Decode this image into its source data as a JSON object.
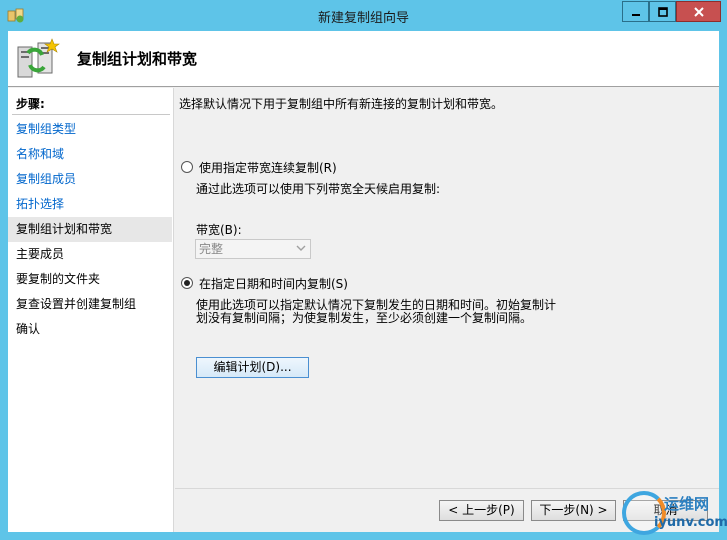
{
  "window": {
    "title": "新建复制组向导"
  },
  "header": {
    "title": "复制组计划和带宽"
  },
  "sidebar": {
    "heading": "步骤:",
    "items": [
      {
        "label": "复制组类型"
      },
      {
        "label": "名称和域"
      },
      {
        "label": "复制组成员"
      },
      {
        "label": "拓扑选择"
      },
      {
        "label": "复制组计划和带宽"
      },
      {
        "label": "主要成员"
      },
      {
        "label": "要复制的文件夹"
      },
      {
        "label": "复查设置并创建复制组"
      },
      {
        "label": "确认"
      }
    ]
  },
  "main": {
    "intro": "选择默认情况下用于复制组中所有新连接的复制计划和带宽。",
    "option1": {
      "label": "使用指定带宽连续复制(R)",
      "desc": "通过此选项可以使用下列带宽全天候启用复制:"
    },
    "bandwidth": {
      "label": "带宽(B):",
      "value": "完整"
    },
    "option2": {
      "label": "在指定日期和时间内复制(S)",
      "desc_line1": "使用此选项可以指定默认情况下复制发生的日期和时间。初始复制计",
      "desc_line2": "划没有复制间隔；为使复制发生，至少必须创建一个复制间隔。"
    },
    "edit_button": "编辑计划(D)..."
  },
  "footer": {
    "prev": "< 上一步(P)",
    "next": "下一步(N) >",
    "cancel": "取消"
  },
  "watermark": {
    "cn": "运维网",
    "url": "iyunv.com"
  }
}
